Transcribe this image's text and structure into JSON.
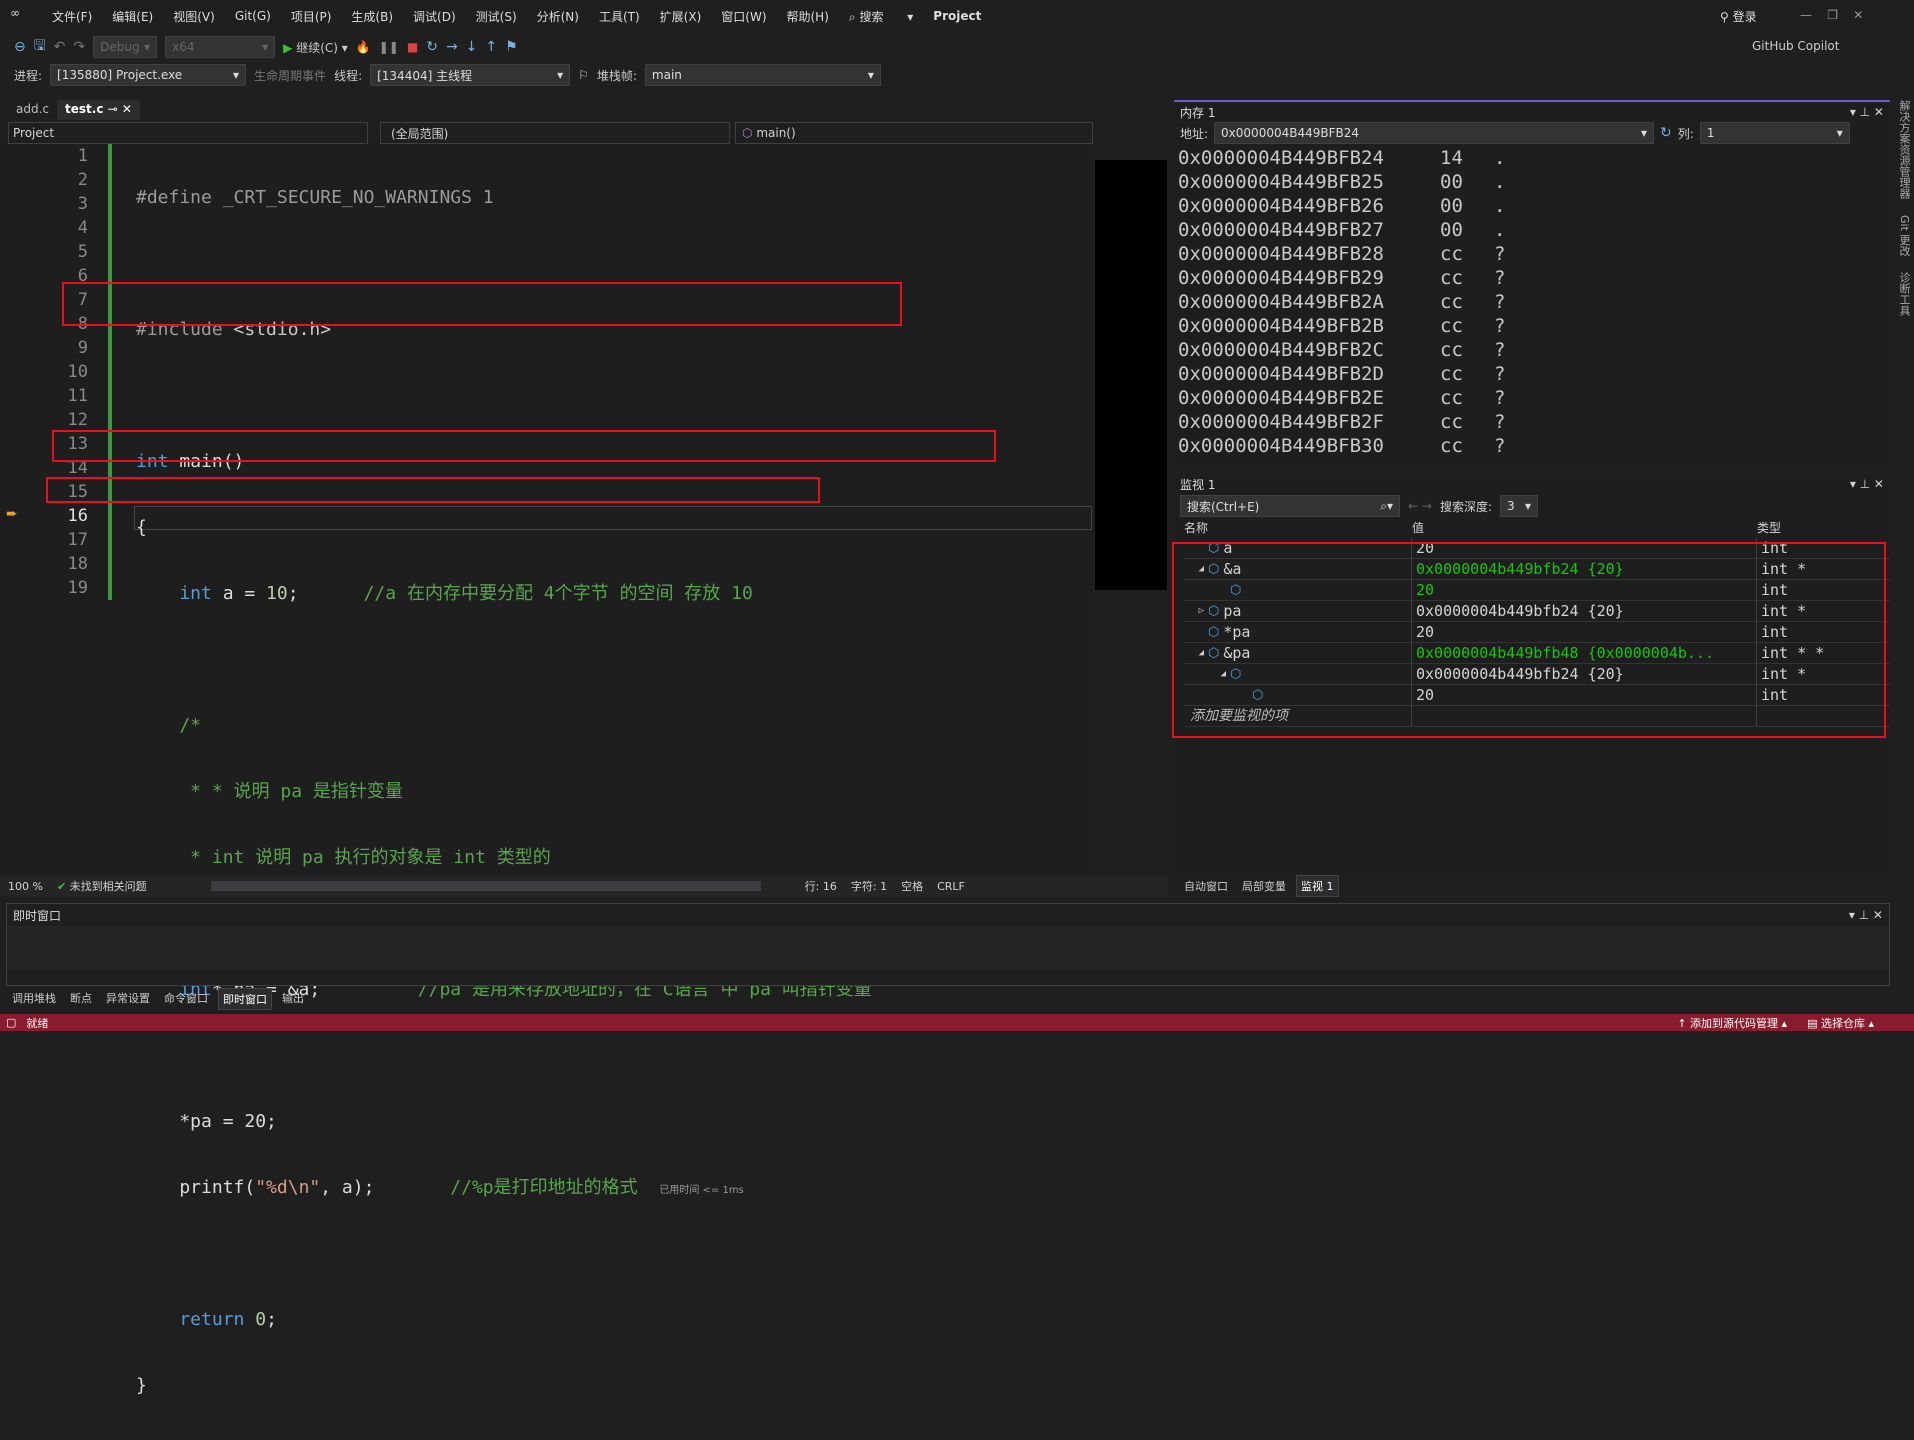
{
  "menu": [
    "文件(F)",
    "编辑(E)",
    "视图(V)",
    "Git(G)",
    "项目(P)",
    "生成(B)",
    "调试(D)",
    "测试(S)",
    "分析(N)",
    "工具(T)",
    "扩展(X)",
    "窗口(W)",
    "帮助(H)"
  ],
  "search_label": "搜索",
  "solution_name": "Project",
  "login_label": "登录",
  "copilot_label": "GitHub Copilot",
  "toolbar": {
    "config": "Debug",
    "platform": "x64",
    "continue_label": "继续(C)"
  },
  "debugbar": {
    "process_label": "进程:",
    "process_value": "[135880] Project.exe",
    "lifecycle_label": "生命周期事件",
    "thread_label": "线程:",
    "thread_value": "[134404] 主线程",
    "stack_label": "堆栈帧:",
    "stack_value": "main"
  },
  "tabs": [
    {
      "label": "add.c"
    },
    {
      "label": "test.c"
    }
  ],
  "navbar": {
    "project": "Project",
    "scope": "(全局范围)",
    "function": "main()"
  },
  "code": {
    "line_numbers": [
      "1",
      "2",
      "3",
      "4",
      "5",
      "6",
      "7",
      "8",
      "9",
      "10",
      "11",
      "12",
      "13",
      "14",
      "15",
      "16",
      "17",
      "18",
      "19"
    ],
    "l1a": "#define ",
    "l1b": "_CRT_SECURE_NO_WARNINGS 1",
    "l3a": "#include ",
    "l3b": "<stdio.h>",
    "l5a": "int",
    " l5b": " main()",
    "l6": "{",
    "l7a": "    int",
    " l7b": " a = ",
    "l7c": "10",
    ";": ";",
    "l7d": ";      ",
    "l7e": "//a 在内存中要分配 4个字节 的空间 存放 10",
    "l9": "    /*",
    "l10": "     * * 说明 pa 是指针变量",
    "l11": "     * int 说明 pa 执行的对象是 int 类型的",
    "l12": "     */",
    "l13a": "    int",
    "l13b": "* pa = &a;         ",
    "l13c": "//pa 是用来存放地址的，在 C语言 中 pa 叫指针变量",
    "l15": "    *pa = 20;",
    "l16a": "    printf(",
    "l16b": "\"%d\\n\"",
    "l16c": ", a);       ",
    "l16d": "//%p是打印地址的格式",
    "l16e": "已用时间 <= 1ms",
    "l18a": "    return ",
    "l18b": "0",
    "l19": "}"
  },
  "editor_status": {
    "zoom": "100 %",
    "issues": "未找到相关问题",
    "line": "行: 16",
    "char": "字符: 1",
    "spaces": "空格",
    "eol": "CRLF"
  },
  "memory": {
    "title": "内存 1",
    "address_label": "地址:",
    "address_value": "0x0000004B449BFB24",
    "columns_label": "列:",
    "columns_value": "1",
    "rows": [
      [
        "0x0000004B449BFB24",
        "14",
        "."
      ],
      [
        "0x0000004B449BFB25",
        "00",
        "."
      ],
      [
        "0x0000004B449BFB26",
        "00",
        "."
      ],
      [
        "0x0000004B449BFB27",
        "00",
        "."
      ],
      [
        "0x0000004B449BFB28",
        "cc",
        "?"
      ],
      [
        "0x0000004B449BFB29",
        "cc",
        "?"
      ],
      [
        "0x0000004B449BFB2A",
        "cc",
        "?"
      ],
      [
        "0x0000004B449BFB2B",
        "cc",
        "?"
      ],
      [
        "0x0000004B449BFB2C",
        "cc",
        "?"
      ],
      [
        "0x0000004B449BFB2D",
        "cc",
        "?"
      ],
      [
        "0x0000004B449BFB2E",
        "cc",
        "?"
      ],
      [
        "0x0000004B449BFB2F",
        "cc",
        "?"
      ],
      [
        "0x0000004B449BFB30",
        "cc",
        "?"
      ]
    ]
  },
  "watch": {
    "title": "监视 1",
    "search_placeholder": "搜索(Ctrl+E)",
    "depth_label": "搜索深度:",
    "depth_value": "3",
    "headers": [
      "名称",
      "值",
      "类型"
    ],
    "rows": [
      {
        "name": "a",
        "value": "20",
        "type": "int",
        "expander": "",
        "indent": 0,
        "changed": false
      },
      {
        "name": "&a",
        "value": "0x0000004b449bfb24 {20}",
        "type": "int *",
        "expander": "◢",
        "indent": 0,
        "changed": true
      },
      {
        "name": "",
        "value": "20",
        "type": "int",
        "expander": "",
        "indent": 1,
        "changed": true
      },
      {
        "name": "pa",
        "value": "0x0000004b449bfb24 {20}",
        "type": "int *",
        "expander": "▷",
        "indent": 0,
        "changed": false
      },
      {
        "name": "*pa",
        "value": "20",
        "type": "int",
        "expander": "",
        "indent": 0,
        "changed": false
      },
      {
        "name": "&pa",
        "value": "0x0000004b449bfb48 {0x0000004b...",
        "type": "int * *",
        "expander": "◢",
        "indent": 0,
        "changed": true
      },
      {
        "name": "",
        "value": "0x0000004b449bfb24 {20}",
        "type": "int *",
        "expander": "◢",
        "indent": 1,
        "changed": false
      },
      {
        "name": "",
        "value": "20",
        "type": "int",
        "expander": "",
        "indent": 2,
        "changed": false
      }
    ],
    "add_placeholder": "添加要监视的项"
  },
  "watch_tabs": [
    "自动窗口",
    "局部变量",
    "监视 1"
  ],
  "immediate": {
    "title": "即时窗口"
  },
  "bottom_tabs": [
    "调用堆栈",
    "断点",
    "异常设置",
    "命令窗口",
    "即时窗口",
    "输出"
  ],
  "right_strip": [
    "解决方案资源管理器",
    "Git 更改",
    "诊断工具"
  ],
  "statusbar": {
    "ready": "就绪",
    "add_source": "添加到源代码管理",
    "select_repo": "选择仓库"
  },
  "colors": {
    "status_bg": "#8a1a2e",
    "highlight": "#e81123",
    "changed": "#16c60c"
  }
}
